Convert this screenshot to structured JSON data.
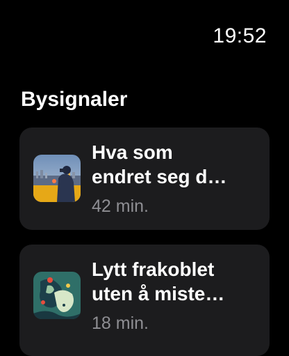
{
  "status_bar": {
    "time": "19:52"
  },
  "section": {
    "title": "Bysignaler"
  },
  "episodes": [
    {
      "title": "Hva som\nendret seg d…",
      "duration": "42 min.",
      "artwork": "city-skyline-person-artwork"
    },
    {
      "title": "Lytt frakoblet\nuten å miste…",
      "duration": "18 min.",
      "artwork": "abstract-map-artwork"
    }
  ],
  "colors": {
    "background": "#000000",
    "card": "#1c1c1e",
    "secondary_text": "#8e8e93"
  }
}
